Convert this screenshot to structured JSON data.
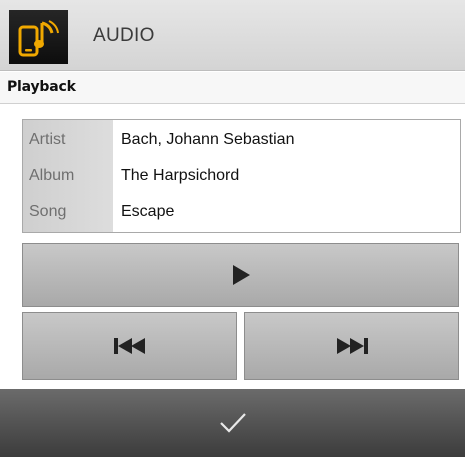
{
  "header": {
    "title": "AUDIO",
    "icon": "phone-music-icon",
    "accent_color": "#f0a800"
  },
  "subheader": {
    "title": "Playback"
  },
  "track_info": {
    "rows": [
      {
        "label": "Artist",
        "value": "Bach, Johann Sebastian"
      },
      {
        "label": "Album",
        "value": "The Harpsichord"
      },
      {
        "label": "Song",
        "value": "Escape"
      }
    ]
  },
  "controls": {
    "play_icon": "play-icon",
    "previous_icon": "skip-previous-icon",
    "next_icon": "skip-next-icon"
  },
  "footer": {
    "confirm_icon": "checkmark-icon"
  }
}
